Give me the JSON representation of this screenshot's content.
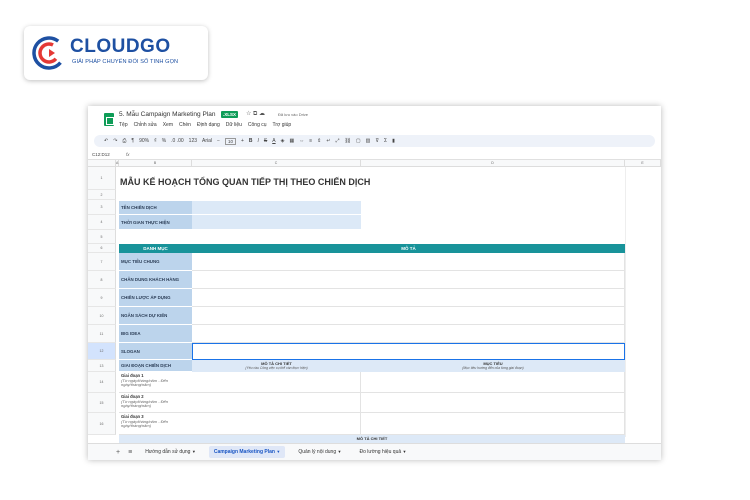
{
  "logo": {
    "name": "CLOUDGO",
    "tagline": "GIẢI PHÁP CHUYỂN ĐỔI SỐ TINH GỌN"
  },
  "window": {
    "doc_title": "5. Mẫu Campaign Marketing Plan",
    "file_badge": ".XLSX",
    "title_icons": "☆ ⧉ ☁",
    "saved_status": "Đã lưu vào Drive",
    "menu": [
      "Tệp",
      "Chỉnh sửa",
      "Xem",
      "Chèn",
      "Định dạng",
      "Dữ liệu",
      "Công cụ",
      "Trợ giúp"
    ],
    "toolbar": {
      "zoom": "90%",
      "currency": "₫",
      "percent": "%",
      "decimals": ".0 .00",
      "number_format": "123",
      "font": "Arial",
      "font_size": "10"
    },
    "cell_ref": "C12:D12",
    "fx": "fx",
    "columns": [
      "A",
      "B",
      "C",
      "D",
      "E"
    ],
    "rows": [
      "1",
      "2",
      "3",
      "4",
      "5",
      "6",
      "7",
      "8",
      "9",
      "10",
      "11",
      "12",
      "13",
      "14",
      "15",
      "16"
    ]
  },
  "sheet": {
    "title": "MẪU KẾ HOẠCH TỔNG QUAN TIẾP THỊ THEO CHIẾN DỊCH",
    "campaign_name_label": "TÊN CHIẾN DỊCH",
    "period_label": "THỜI GIAN THỰC HIỆN",
    "col_category": "DANH MỤC",
    "col_description": "MÔ TẢ",
    "categories": [
      "MỤC TIÊU CHUNG",
      "CHÂN DUNG KHÁCH HÀNG",
      "CHIẾN LƯỢC ÁP DỤNG",
      "NGÂN SÁCH DỰ KIẾN",
      "BIG IDEA",
      "SLOGAN",
      "GIAI ĐOẠN CHIẾN DỊCH"
    ],
    "detail_header": "MÔ TẢ CHI TIẾT",
    "detail_hint": "(Yêu cầu Công việc cụ thể cần thực hiện)",
    "goal_header": "MỤC TIÊU",
    "goal_hint": "(Mục tiêu hướng đến của từng giai đoạn)",
    "phases": [
      {
        "name": "Giai đoạn 1",
        "hint": "(Từ ngày/tháng/năm - Đến ngày/tháng/năm)"
      },
      {
        "name": "Giai đoạn 2",
        "hint": "(Từ ngày/tháng/năm - Đến ngày/tháng/năm)"
      },
      {
        "name": "Giai đoạn 3",
        "hint": "(Từ ngày/tháng/năm - Đến ngày/tháng/năm)"
      }
    ],
    "partial_header": "MÔ TẢ CHI TIẾT"
  },
  "tabs": {
    "add": "+",
    "list": "≡",
    "items": [
      "Hướng dẫn sử dụng",
      "Campaign Marketing Plan",
      "Quản lý nội dung",
      "Đo lường hiệu quả"
    ],
    "active_index": 1
  },
  "colors": {
    "brand_blue": "#1e50a2",
    "brand_red": "#e53935",
    "teal": "#18939a",
    "label_blue": "#bcd4ec",
    "sheets_green": "#0f9d58"
  }
}
